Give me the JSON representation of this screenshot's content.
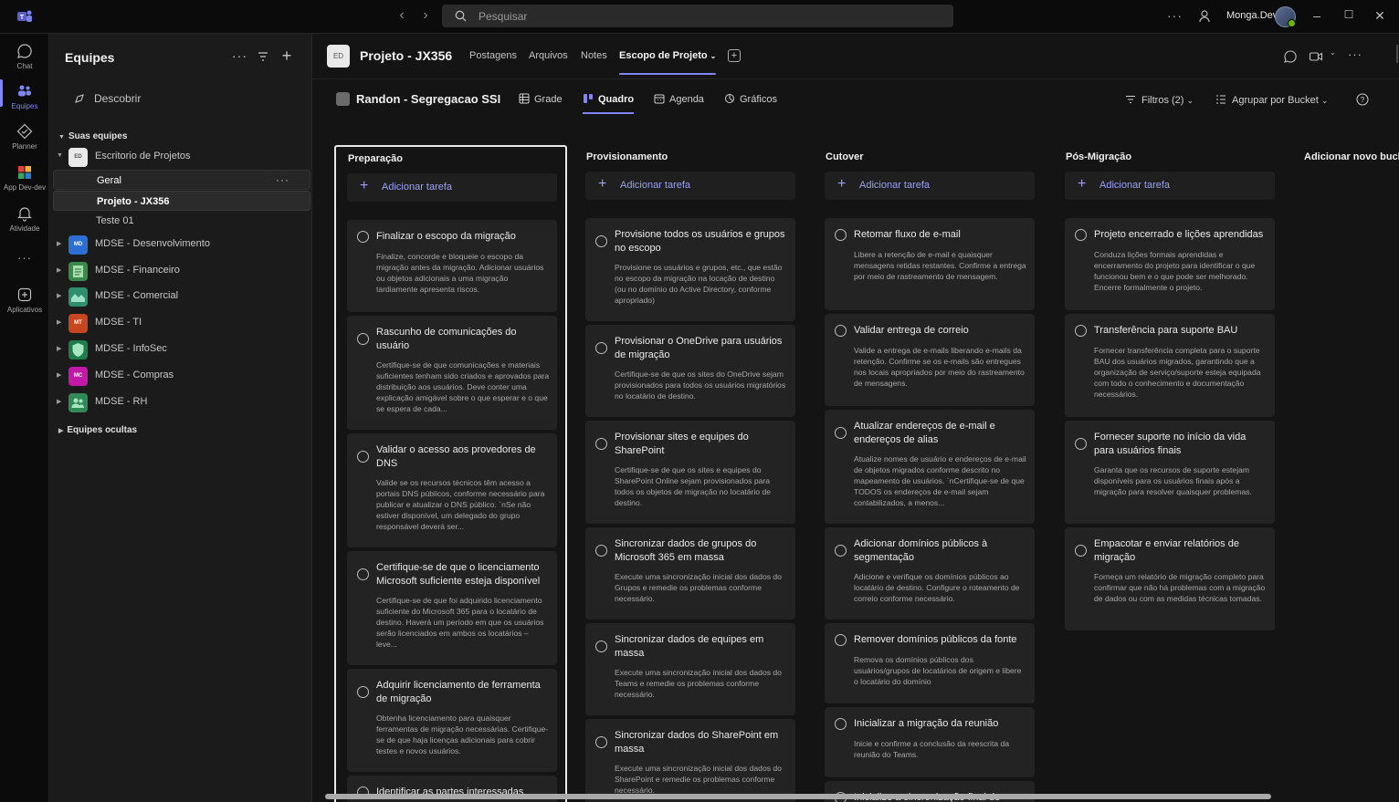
{
  "titlebar": {
    "search_placeholder": "Pesquisar",
    "user_name": "Monga.Dev"
  },
  "rail": [
    {
      "label": "Chat",
      "icon": "chat-icon"
    },
    {
      "label": "Equipes",
      "icon": "teams-icon",
      "active": true
    },
    {
      "label": "Planner",
      "icon": "planner-icon"
    },
    {
      "label": "App Dev-dev",
      "icon": "app-icon"
    },
    {
      "label": "Atividade",
      "icon": "bell-icon"
    },
    {
      "label": "Aplicativos",
      "icon": "add-apps-icon"
    }
  ],
  "teams_panel": {
    "title": "Equipes",
    "discover": "Descobrir",
    "your_teams_label": "Suas equipes",
    "hidden_teams_label": "Equipes ocultas",
    "teams": [
      {
        "name": "Escritorio de Projetos",
        "initials": "ED",
        "color": "#e9e9e9"
      },
      {
        "name": "MDSE - Desenvolvimento",
        "initials": "MD",
        "color": "#2b6fd4"
      },
      {
        "name": "MDSE - Financeiro",
        "initials": "",
        "color": "#3a8a4a"
      },
      {
        "name": "MDSE - Comercial",
        "initials": "",
        "color": "#2e8f6e"
      },
      {
        "name": "MDSE - TI",
        "initials": "MT",
        "color": "#c7461f"
      },
      {
        "name": "MDSE - InfoSec",
        "initials": "",
        "color": "#1e7d4b"
      },
      {
        "name": "MDSE - Compras",
        "initials": "MC",
        "color": "#c219a8"
      },
      {
        "name": "MDSE - RH",
        "initials": "",
        "color": "#2f8a58"
      }
    ],
    "channels": [
      "Geral",
      "Projeto - JX356",
      "Teste 01"
    ]
  },
  "channel_header": {
    "avatar": "ED",
    "title": "Projeto - JX356",
    "tabs": [
      "Postagens",
      "Arquivos",
      "Notes",
      "Escopo de Projeto"
    ]
  },
  "plan_bar": {
    "title": "Randon - Segregacao SSI",
    "views": [
      "Grade",
      "Quadro",
      "Agenda",
      "Gráficos"
    ],
    "filters": "Filtros (2)",
    "group_by": "Agrupar por Bucket"
  },
  "board": {
    "add_task_label": "Adicionar tarefa",
    "add_bucket_label": "Adicionar novo bucket",
    "buckets": [
      {
        "name": "Preparação",
        "tasks": [
          {
            "title": "Finalizar o escopo da migração",
            "desc": "Finalize, concorde e bloqueie o escopo da migração antes da migração. Adicionar usuários ou objetos adicionais a uma migração tardiamente apresenta riscos."
          },
          {
            "title": "Rascunho de comunicações do usuário",
            "desc": "Certifique-se de que comunicações e materiais suficientes tenham sido criados e aprovados para distribuição aos usuários. Deve conter uma explicação amigável sobre o que esperar e o que se espera de cada..."
          },
          {
            "title": "Validar o acesso aos provedores de DNS",
            "desc": "Valide se os recursos técnicos têm acesso a portais DNS públicos, conforme necessário para publicar e atualizar o DNS público. `nSe não estiver disponível, um delegado do grupo responsável deverá ser..."
          },
          {
            "title": "Certifique-se de que o licenciamento Microsoft suficiente esteja disponível",
            "desc": "Certifique-se de que foi adquirido licenciamento suficiente do Microsoft 365 para o locatário de destino. Haverá um período em que os usuários serão licenciados em ambos os locatários – leve..."
          },
          {
            "title": "Adquirir licenciamento de ferramenta de migração",
            "desc": "Obtenha licenciamento para quaisquer ferramentas de migração necessárias. Certifique-se de que haja licenças adicionais para cobrir testes e novos usuários."
          },
          {
            "title": "Identificar as partes interessadas",
            "desc": ""
          }
        ]
      },
      {
        "name": "Provisionamento",
        "tasks": [
          {
            "title": "Provisione todos os usuários e grupos no escopo",
            "desc": "Provisione os usuários e grupos, etc., que estão no escopo da migração na locação de destino (ou no domínio do Active Directory, conforme apropriado)"
          },
          {
            "title": "Provisionar o OneDrive para usuários de migração",
            "desc": "Certifique-se de que os sites do OneDrive sejam provisionados para todos os usuários migratórios no locatário de destino."
          },
          {
            "title": "Provisionar sites e equipes do SharePoint",
            "desc": "Certifique-se de que os sites e equipes do SharePoint Online sejam provisionados para todos os objetos de migração no locatário de destino."
          },
          {
            "title": "Sincronizar dados de grupos do Microsoft 365 em massa",
            "desc": "Execute uma sincronização inicial dos dados do Grupos e remedie os problemas conforme necessário."
          },
          {
            "title": "Sincronizar dados de equipes em massa",
            "desc": "Execute uma sincronização inicial dos dados do Teams e remedie os problemas conforme necessário."
          },
          {
            "title": "Sincronizar dados do SharePoint em massa",
            "desc": "Execute uma sincronização inicial dos dados do SharePoint e remedie os problemas conforme necessário."
          }
        ]
      },
      {
        "name": "Cutover",
        "tasks": [
          {
            "title": "Retomar fluxo de e-mail",
            "desc": "Libere a retenção de e-mail e quaisquer mensagens retidas restantes. Confirme a entrega por meio de rastreamento de mensagem."
          },
          {
            "title": "Validar entrega de correio",
            "desc": "Valide a entrega de e-mails liberando e-mails da retenção. Confirme se os e-mails são entregues nos locais apropriados por meio do rastreamento de mensagens."
          },
          {
            "title": "Atualizar endereços de e-mail e endereços de alias",
            "desc": "Atualize nomes de usuário e endereços de e-mail de objetos migrados conforme descrito no mapeamento de usuários. `nCertifique-se de que TODOS os endereços de e-mail sejam contabilizados, a menos..."
          },
          {
            "title": "Adicionar domínios públicos à segmentação",
            "desc": "Adicione e verifique os domínios públicos ao locatário de destino. Configure o roteamento de correio conforme necessário."
          },
          {
            "title": "Remover domínios públicos da fonte",
            "desc": "Remova os domínios públicos dos usuários/grupos de locatários de origem e libere o locatário do domínio"
          },
          {
            "title": "Inicializar a migração da reunião",
            "desc": "Inicie e confirme a conclusão da reescrita da reunião do Teams."
          },
          {
            "title": "Inicialize a sincronização final de",
            "desc": ""
          }
        ]
      },
      {
        "name": "Pós-Migração",
        "tasks": [
          {
            "title": "Projeto encerrado e lições aprendidas",
            "desc": "Conduza lições formais aprendidas e encerramento do projeto para identificar o que funcionou bem e o que pode ser melhorado. Encerre formalmente o projeto."
          },
          {
            "title": "Transferência para suporte BAU",
            "desc": "Fornecer transferência completa para o suporte BAU dos usuários migrados, garantindo que a organização de serviço/suporte esteja equipada com todo o conhecimento e documentação necessários."
          },
          {
            "title": "Fornecer suporte no início da vida para usuários finais",
            "desc": "Garanta que os recursos de suporte estejam disponíveis para os usuários finais após a migração para resolver quaisquer problemas."
          },
          {
            "title": "Empacotar e enviar relatórios de migração",
            "desc": "Forneça um relatório de migração completo para confirmar que não há problemas com a migração de dados ou com as medidas técnicas tomadas."
          }
        ]
      }
    ]
  }
}
